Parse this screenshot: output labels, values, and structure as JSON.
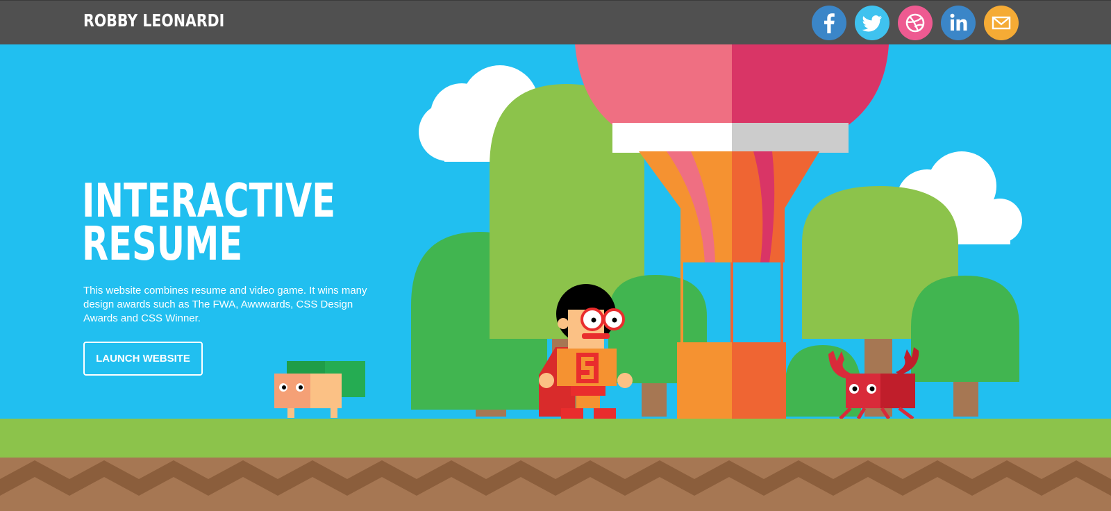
{
  "brand": {
    "name": "ROBBY LEONARDI"
  },
  "social": [
    {
      "name": "Facebook",
      "color": "#3b86c8",
      "icon": "facebook-icon"
    },
    {
      "name": "Twitter",
      "color": "#3fc2ef",
      "icon": "twitter-icon"
    },
    {
      "name": "Dribbble",
      "color": "#ee5a91",
      "icon": "dribbble-icon"
    },
    {
      "name": "LinkedIn",
      "color": "#3b86c8",
      "icon": "linkedin-icon"
    },
    {
      "name": "Email",
      "color": "#f5ab35",
      "icon": "envelope-icon"
    }
  ],
  "hero": {
    "title_line1": "INTERACTIVE",
    "title_line2": "RESUME",
    "description": "This website combines resume and video game. It wins many design awards such as The FWA, Awwwards, CSS Design Awards and CSS Winner.",
    "cta_label": "LAUNCH WEBSITE"
  },
  "colors": {
    "sky": "#21bff0",
    "topbar": "#505050",
    "grass": "#8cc34b",
    "dirt": "#a67753",
    "dirt_dark": "#8b5e3c"
  }
}
